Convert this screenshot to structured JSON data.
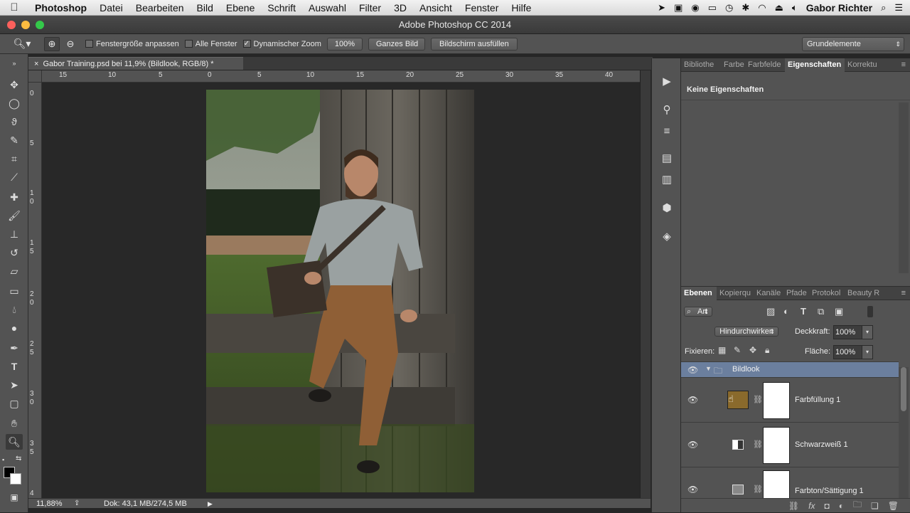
{
  "menubar": {
    "apple": "",
    "items": [
      "Photoshop",
      "Datei",
      "Bearbeiten",
      "Bild",
      "Ebene",
      "Schrift",
      "Auswahl",
      "Filter",
      "3D",
      "Ansicht",
      "Fenster",
      "Hilfe"
    ],
    "user": "Gabor Richter"
  },
  "window": {
    "title": "Adobe Photoshop CC 2014"
  },
  "options": {
    "fit_window": "Fenstergröße anpassen",
    "all_windows": "Alle Fenster",
    "dynamic_zoom": "Dynamischer Zoom",
    "zoom_value": "100%",
    "whole_image": "Ganzes Bild",
    "fill_screen": "Bildschirm ausfüllen",
    "workspace": "Grundelemente"
  },
  "document": {
    "tab": "Gabor Training.psd bei 11,9% (Bildlook, RGB/8) *",
    "close": "×"
  },
  "ruler": {
    "h_labels": [
      "15",
      "10",
      "5",
      "0",
      "5",
      "10",
      "15",
      "20",
      "25",
      "30",
      "35",
      "40"
    ],
    "v_labels": [
      "0",
      "5",
      "10",
      "15",
      "20",
      "25",
      "30",
      "35",
      "4"
    ]
  },
  "status": {
    "zoom": "11,88%",
    "doc": "Dok: 43,1 MB/274,5 MB"
  },
  "properties_panel": {
    "tabs": [
      "Bibliothe",
      "Farbe",
      "Farbfelde",
      "Eigenschaften",
      "Korrektu"
    ],
    "active_tab": "Eigenschaften",
    "content": "Keine Eigenschaften"
  },
  "layers_panel": {
    "tabs": [
      "Ebenen",
      "Kopierqu",
      "Kanäle",
      "Pfade",
      "Protokol",
      "Beauty R"
    ],
    "filter": "Art",
    "blend_mode": "Hindurchwirken",
    "opacity_label": "Deckkraft:",
    "opacity": "100%",
    "lock_label": "Fixieren:",
    "fill_label": "Fläche:",
    "fill": "100%",
    "layers": [
      {
        "name": "Bildlook",
        "type": "group"
      },
      {
        "name": "Farbfüllung 1",
        "type": "fill",
        "color": "#8a6a2c"
      },
      {
        "name": "Schwarzweiß 1",
        "type": "adjustment"
      },
      {
        "name": "Farbton/Sättigung 1",
        "type": "adjustment"
      }
    ]
  },
  "colors": {
    "accent_selected_row": "#6b7f9e",
    "foreground": "#000000",
    "background": "#ffffff"
  }
}
